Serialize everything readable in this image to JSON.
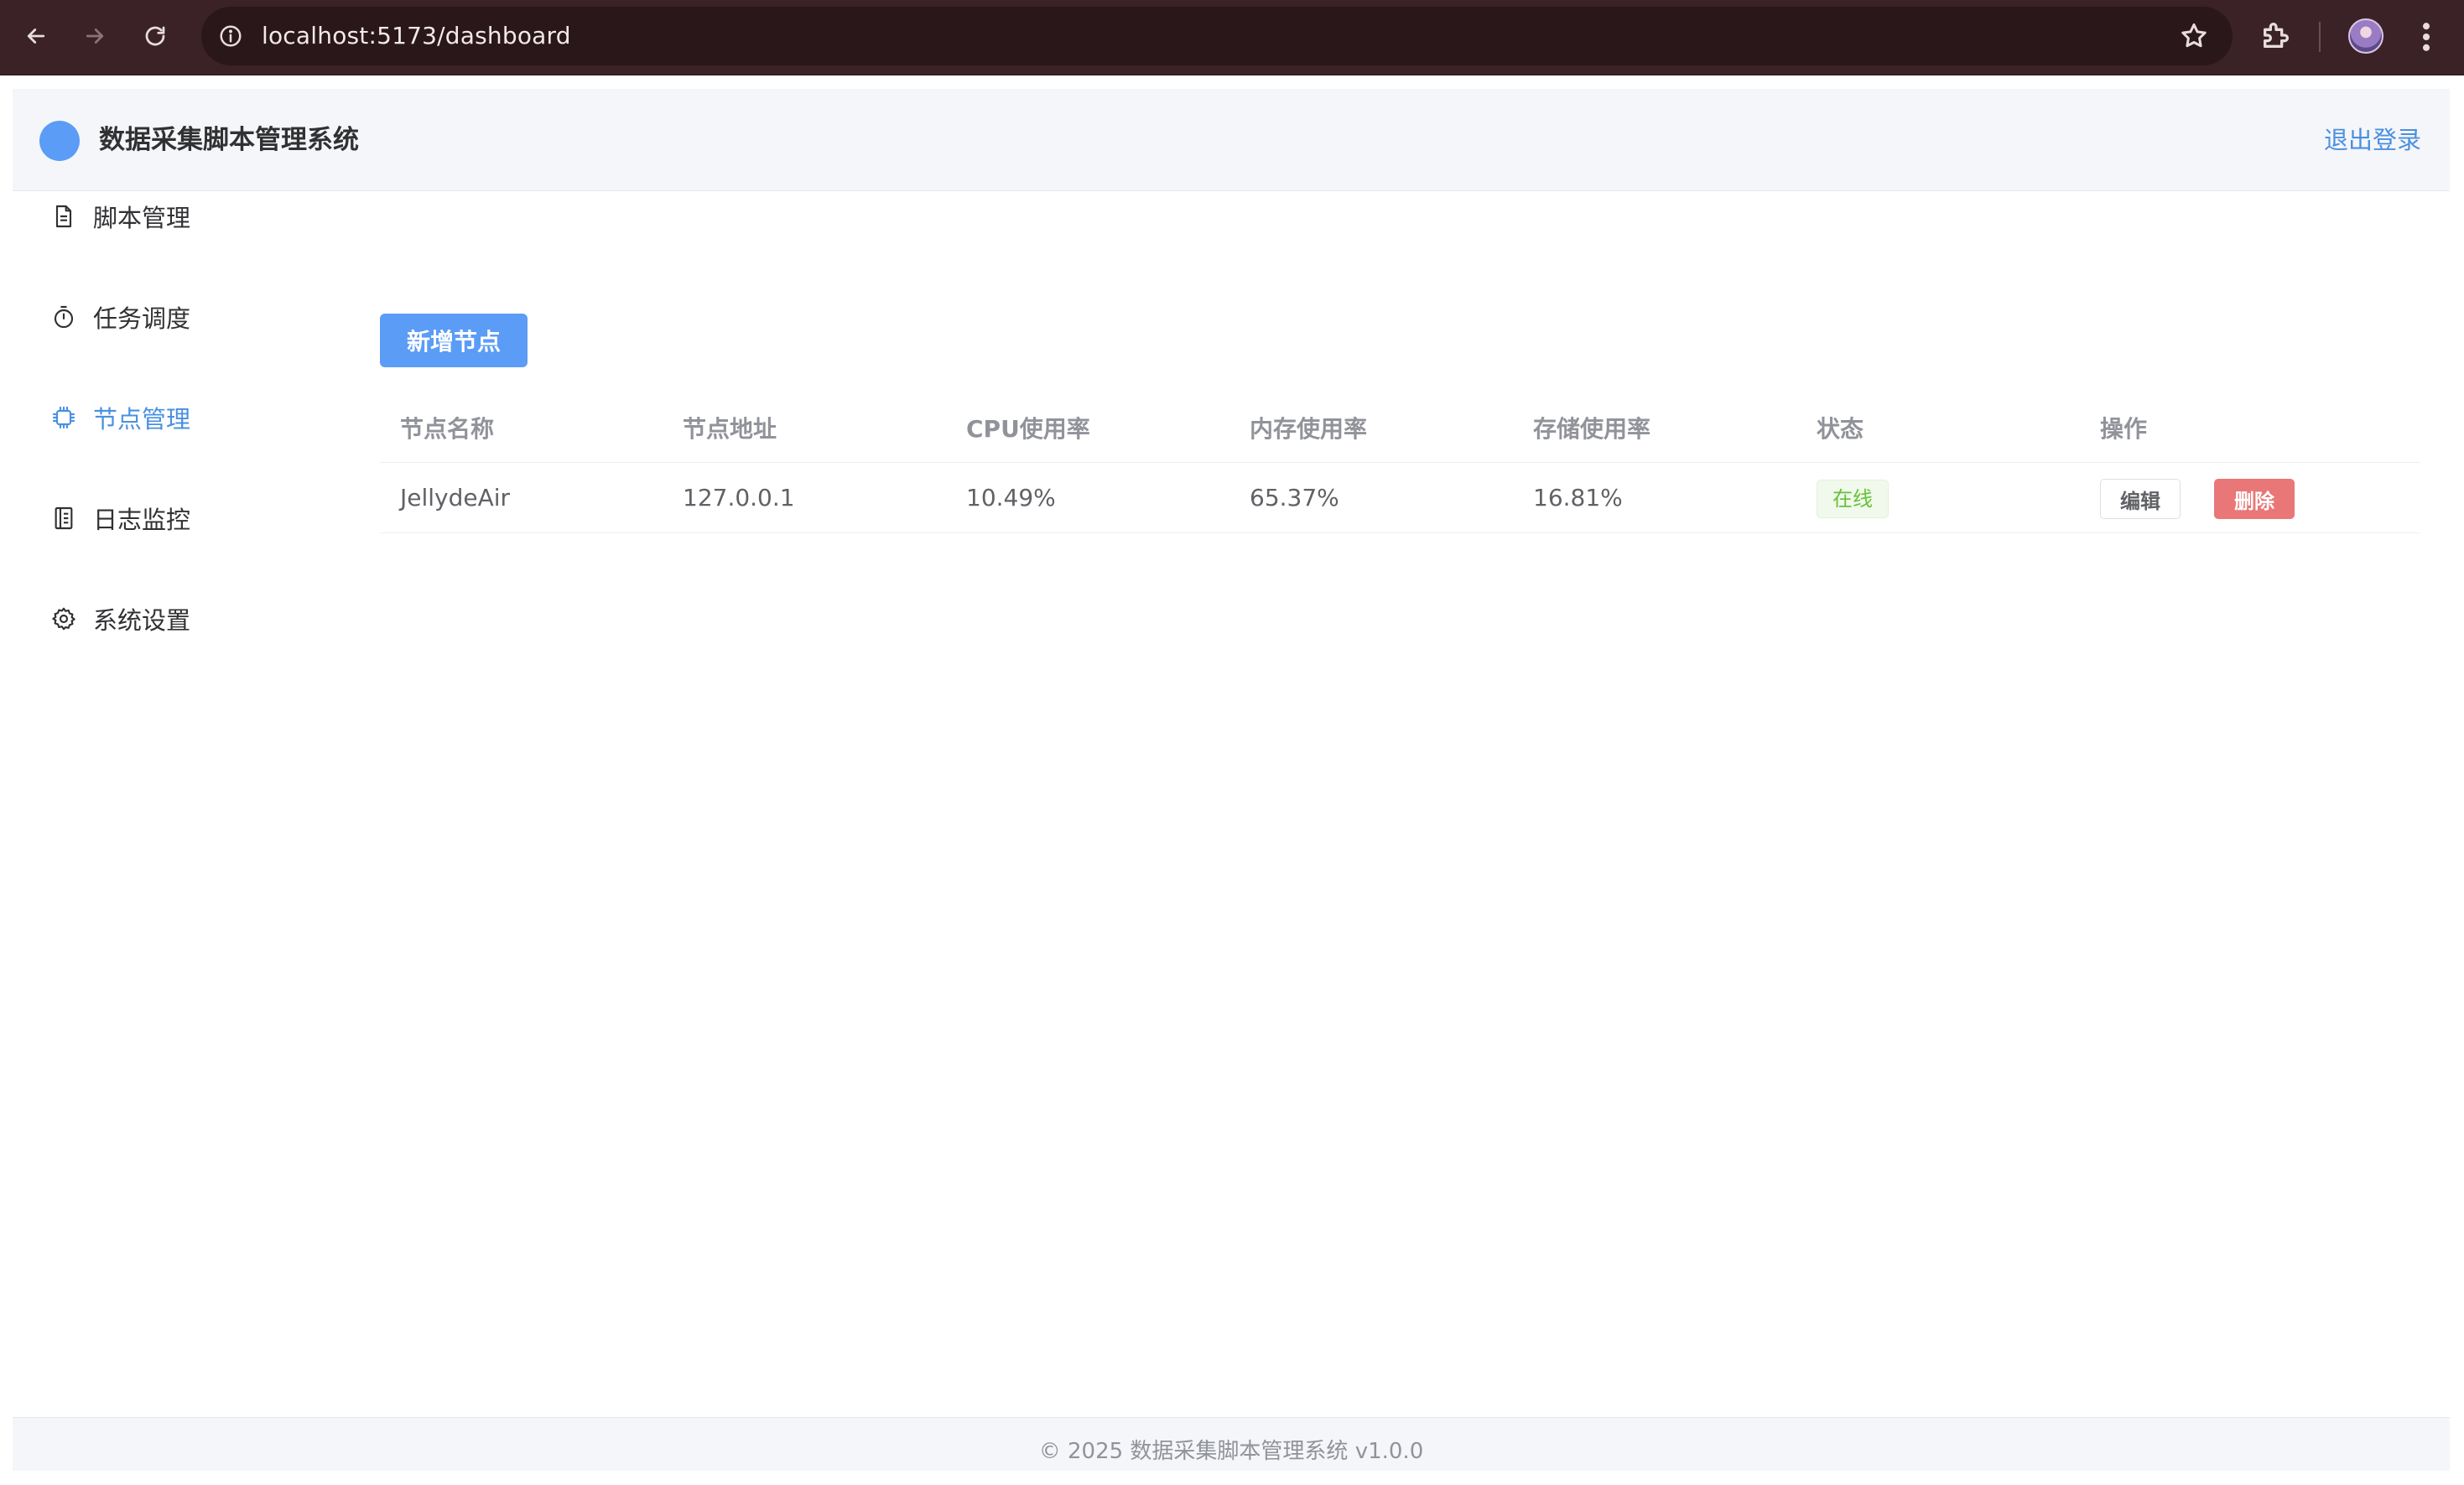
{
  "browser": {
    "url": "localhost:5173/dashboard"
  },
  "header": {
    "title": "数据采集脚本管理系统",
    "logout": "退出登录"
  },
  "sidebar": {
    "items": [
      {
        "label": "脚本管理",
        "icon": "document-icon"
      },
      {
        "label": "任务调度",
        "icon": "stopwatch-icon"
      },
      {
        "label": "节点管理",
        "icon": "cpu-chip-icon",
        "active": true
      },
      {
        "label": "日志监控",
        "icon": "notebook-icon"
      },
      {
        "label": "系统设置",
        "icon": "gear-icon"
      }
    ]
  },
  "main": {
    "add_button": "新增节点",
    "table": {
      "columns": [
        "节点名称",
        "节点地址",
        "CPU使用率",
        "内存使用率",
        "存储使用率",
        "状态",
        "操作"
      ],
      "rows": [
        {
          "name": "JellydeAir",
          "address": "127.0.0.1",
          "cpu": "10.49%",
          "memory": "65.37%",
          "storage": "16.81%",
          "status": "在线",
          "edit": "编辑",
          "delete": "删除"
        }
      ]
    }
  },
  "footer": {
    "text": "© 2025 数据采集脚本管理系统 v1.0.0"
  },
  "colors": {
    "accent": "#4a90e2",
    "primary_button": "#5b9cf6",
    "danger_button": "#e97777",
    "success_tag": "#67c23a",
    "chrome_bg": "#3b2226"
  }
}
